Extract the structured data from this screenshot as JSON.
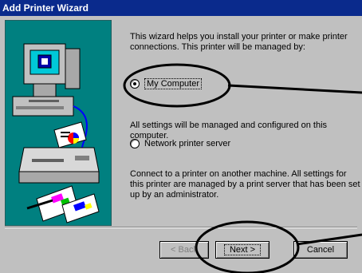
{
  "window": {
    "title": "Add Printer Wizard"
  },
  "intro": {
    "line1": "This wizard helps you install your printer or make printer",
    "line2": "connections.  This printer will be managed by:"
  },
  "options": {
    "my_computer": {
      "label": "My Computer",
      "selected": true,
      "desc_line1": "All settings will be managed and configured on this",
      "desc_line2": "computer."
    },
    "network_server": {
      "label": "Network printer server",
      "selected": false,
      "desc_line1": "Connect to a printer on another machine.  All settings for",
      "desc_line2": "this printer are managed by a print server that has been set",
      "desc_line3": "up by an administrator."
    }
  },
  "buttons": {
    "back": "< Back",
    "next": "Next >",
    "cancel": "Cancel"
  },
  "colors": {
    "titlebar": "#0a2a8c",
    "illustration_bg": "#008080",
    "annotation": "#000000"
  },
  "icons": [
    "computer-icon",
    "printer-icon",
    "documents-icon"
  ]
}
